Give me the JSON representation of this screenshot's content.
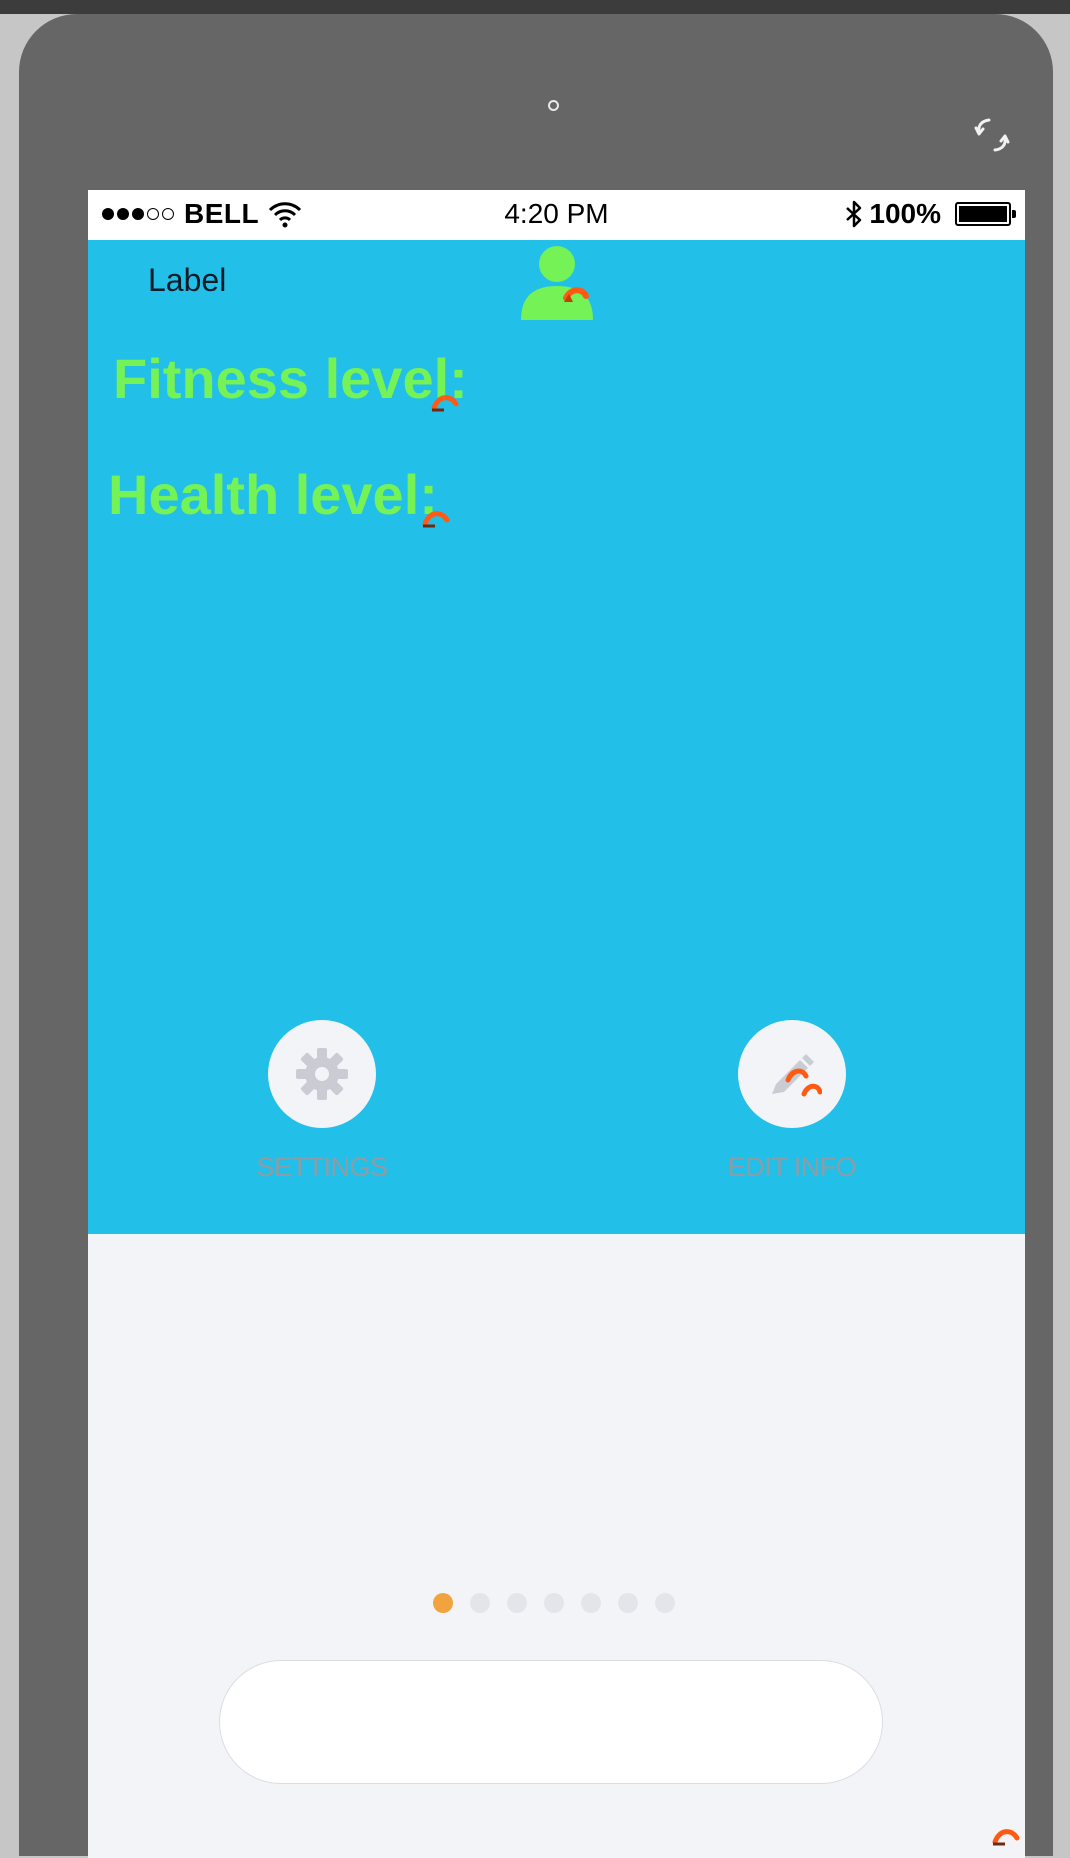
{
  "status_bar": {
    "carrier": "BELL",
    "time": "4:20 PM",
    "battery": "100%",
    "signal_bars_filled": 3,
    "signal_bars_total": 5
  },
  "header": {
    "label": "Label",
    "avatar_icon": "user-icon"
  },
  "levels": {
    "fitness": "Fitness level:",
    "health": "Health level:"
  },
  "actions": {
    "settings": {
      "label": "SETTINGS",
      "icon": "gear-icon"
    },
    "edit_info": {
      "label": "EDIT INFO",
      "icon": "pencil-icon"
    }
  },
  "pager": {
    "count": 7,
    "active_index": 0
  },
  "colors": {
    "background": "#22bfe8",
    "level_text": "#74f256",
    "pager_active": "#f1a33d",
    "marker": "#ff5a14"
  }
}
